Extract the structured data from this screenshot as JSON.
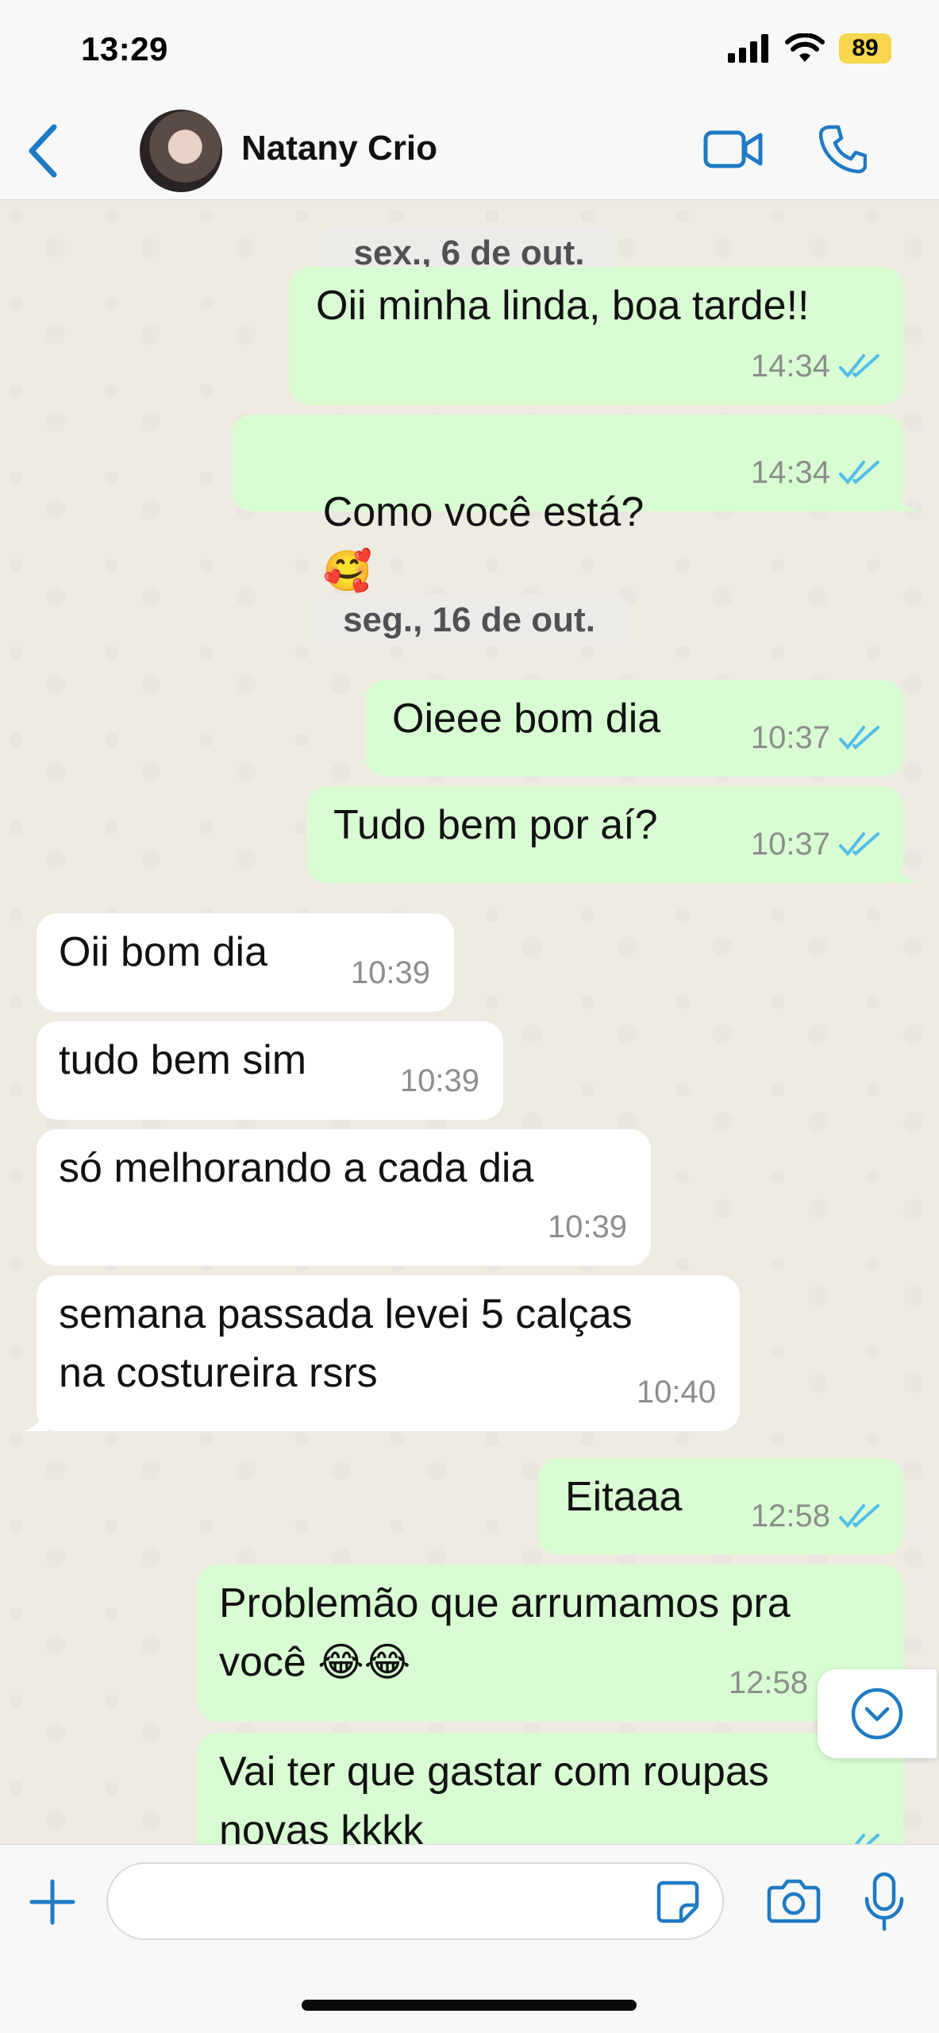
{
  "status_bar": {
    "time": "13:29",
    "battery": "89"
  },
  "header": {
    "contact_name": "Natany Crio"
  },
  "date_separators": [
    "sex., 6 de out.",
    "seg., 16 de out."
  ],
  "messages": [
    {
      "direction": "out",
      "text": "Oii minha linda, boa tarde!!",
      "time": "14:34",
      "read": true
    },
    {
      "direction": "out",
      "text": "Como você está?",
      "emoji": "🥰",
      "time": "14:34",
      "read": true
    },
    {
      "direction": "out",
      "text": "Oieee bom dia",
      "time": "10:37",
      "read": true
    },
    {
      "direction": "out",
      "text": "Tudo bem por aí?",
      "time": "10:37",
      "read": true
    },
    {
      "direction": "in",
      "text": "Oii bom dia",
      "time": "10:39"
    },
    {
      "direction": "in",
      "text": "tudo bem sim",
      "time": "10:39"
    },
    {
      "direction": "in",
      "text": "só melhorando a cada dia",
      "time": "10:39"
    },
    {
      "direction": "in",
      "text": "semana passada levei 5 calças\nna costureira rsrs",
      "time": "10:40"
    },
    {
      "direction": "out",
      "text": "Eitaaa",
      "time": "12:58",
      "read": true
    },
    {
      "direction": "out",
      "text": "Problemão que arrumamos pra\nvocê",
      "emoji": "😂😂",
      "time": "12:58",
      "read": true
    },
    {
      "direction": "out",
      "text": "Vai ter que gastar com roupas\nnovas kkkk",
      "read": true
    }
  ],
  "composer": {
    "input_value": "",
    "input_placeholder": ""
  },
  "colors": {
    "outgoing_bubble": "#d9fdd3",
    "incoming_bubble": "#ffffff",
    "accent_blue": "#1f7ac4",
    "read_tick": "#53bdeb",
    "battery": "#f7d54c"
  },
  "icons": {
    "back": "chevron-left-icon",
    "video": "video-camera-icon",
    "call": "phone-icon",
    "plus": "plus-icon",
    "sticker": "sticker-icon",
    "camera": "camera-icon",
    "mic": "microphone-icon",
    "scroll": "chevron-down-circle-icon"
  }
}
